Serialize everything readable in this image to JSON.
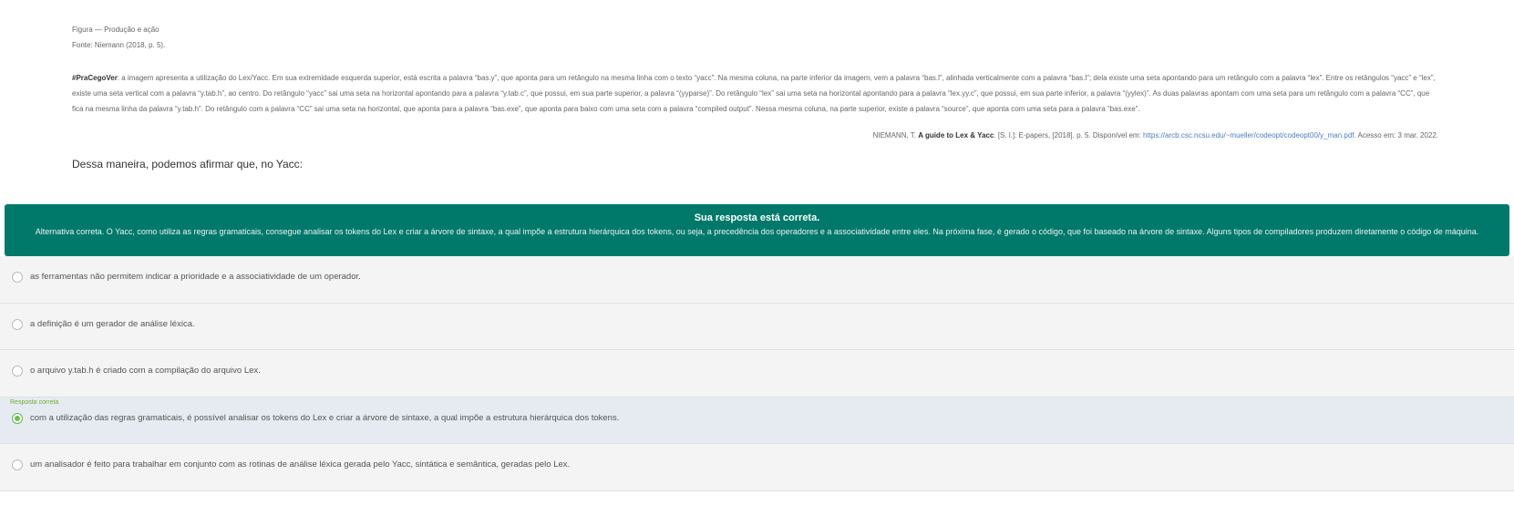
{
  "figure": {
    "title": "Figura — Produção e ação",
    "source": "Fonte: Niemann (2018, p. 5)."
  },
  "description": {
    "tag": "#PraCegoVer",
    "text": ": a imagem apresenta a utilização do Lex/Yacc. Em sua extremidade esquerda superior, está escrita a palavra “bas.y”, que aponta para um retângulo na mesma linha com o texto “yacc”. Na mesma coluna, na parte inferior da imagem, vem a palavra “bas.l”, alinhada verticalmente com a palavra “bas.l”; dela existe uma seta apontando para um retângulo com a palavra “lex”. Entre os retângulos “yacc” e “lex”, existe uma seta vertical com a palavra “y.tab.h”, ao centro. Do retângulo “yacc” sai uma seta na horizontal apontando para a palavra “y.tab.c”, que possui, em sua parte superior, a palavra “(yyparse)”. Do retângulo “lex” sai uma seta na horizontal apontando para a palavra “lex.yy.c”, que possui, em sua parte inferior, a palavra “(yylex)”. As duas palavras apontam com uma seta para um retângulo com a palavra “CC”, que fica na mesma linha da palavra “y.tab.h”. Do retângulo com a palavra “CC” sai uma seta na horizontal, que aponta para a palavra “bas.exe”, que aponta para baixo com uma seta com a palavra “compiled output”. Nessa mesma coluna, na parte superior, existe a palavra “source”, que aponta com uma seta para a palavra “bas.exe”."
  },
  "reference": {
    "prefix": "NIEMANN, T. ",
    "book": "A guide to Lex & Yacc",
    "middle": ". [S. l.]: E-papers, [2018]. p. 5. Disponível em: ",
    "url": "https://arcb.csc.ncsu.edu/~mueller/codeopt/codeopt00/y_man.pdf",
    "suffix": ". Acesso em: 3 mar. 2022."
  },
  "question": "Dessa maneira, podemos afirmar que, no Yacc:",
  "feedback": {
    "title": "Sua resposta está correta.",
    "text": "Alternativa correta. O Yacc, como utiliza as regras gramaticais, consegue analisar os tokens do Lex e criar a árvore de sintaxe, a qual impõe a estrutura hierárquica dos tokens, ou seja, a precedência dos operadores e a associatividade entre eles. Na próxima fase, é gerado o código, que foi baseado na árvore de sintaxe. Alguns tipos de compiladores produzem diretamente o código de máquina.",
    "bg_color": "#00796b"
  },
  "options": [
    {
      "text": "as ferramentas não permitem indicar a prioridade e a associatividade de um operador."
    },
    {
      "text": "a definição é um gerador de análise léxica."
    },
    {
      "text": "o arquivo y.tab.h é criado com a compilação do arquivo Lex."
    },
    {
      "text": "com a utilização das regras gramaticais, é possível analisar os tokens do Lex e criar a árvore de sintaxe, a qual impõe a estrutura hierárquica dos tokens.",
      "correct_label": "Resposta correta",
      "selected": true
    },
    {
      "text": "um analisador é feito para trabalhar em conjunto com as rotinas de análise léxica gerada pelo Yacc, sintática e semântica, geradas pelo Lex."
    }
  ]
}
